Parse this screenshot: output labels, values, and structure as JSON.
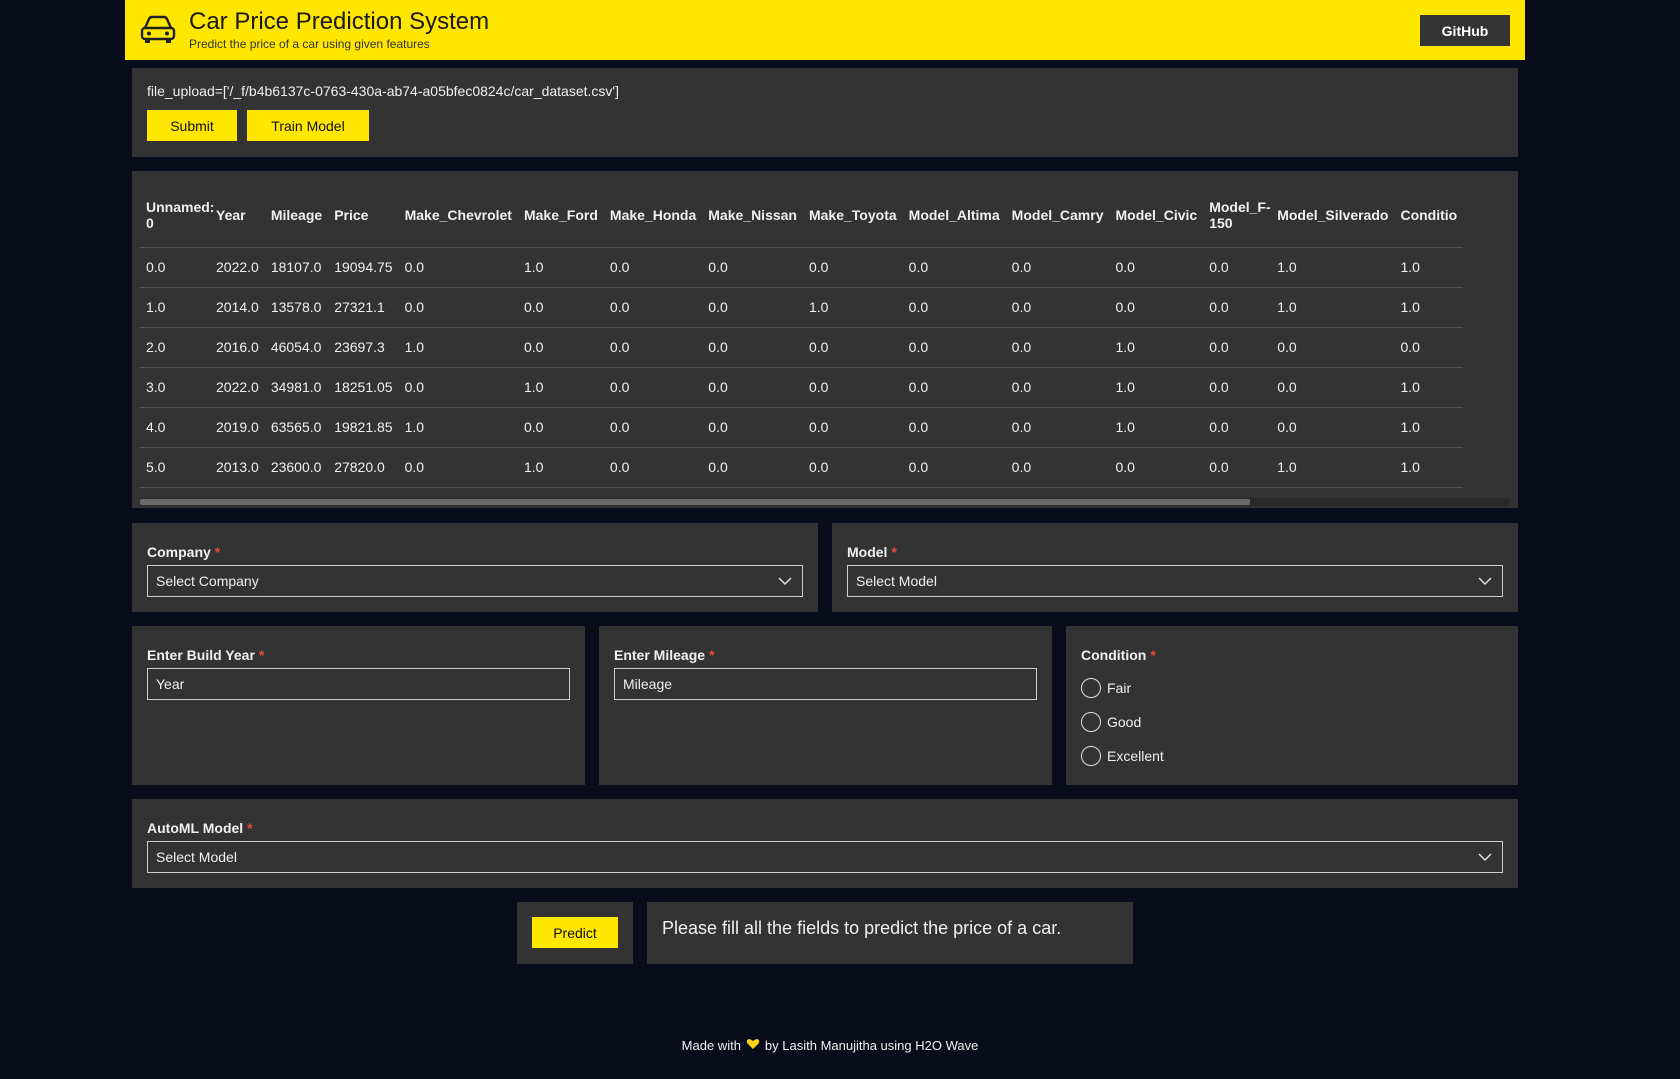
{
  "header": {
    "title": "Car Price Prediction System",
    "subtitle": "Predict the price of a car using given features",
    "github_label": "GitHub",
    "icon": "car-icon",
    "accent_color": "#ffe600"
  },
  "upload": {
    "file_text": "file_upload=['/_f/b4b6137c-0763-430a-ab74-a05bfec0824c/car_dataset.csv']",
    "submit_label": "Submit",
    "train_label": "Train Model"
  },
  "table": {
    "columns": [
      "Unnamed: 0",
      "Year",
      "Mileage",
      "Price",
      "Make_Chevrolet",
      "Make_Ford",
      "Make_Honda",
      "Make_Nissan",
      "Make_Toyota",
      "Model_Altima",
      "Model_Camry",
      "Model_Civic",
      "Model_F-150",
      "Model_Silverado",
      "Conditio"
    ],
    "rows": [
      [
        "0.0",
        "2022.0",
        "18107.0",
        "19094.75",
        "0.0",
        "1.0",
        "0.0",
        "0.0",
        "0.0",
        "0.0",
        "0.0",
        "0.0",
        "0.0",
        "1.0",
        "1.0"
      ],
      [
        "1.0",
        "2014.0",
        "13578.0",
        "27321.1",
        "0.0",
        "0.0",
        "0.0",
        "0.0",
        "1.0",
        "0.0",
        "0.0",
        "0.0",
        "0.0",
        "1.0",
        "1.0"
      ],
      [
        "2.0",
        "2016.0",
        "46054.0",
        "23697.3",
        "1.0",
        "0.0",
        "0.0",
        "0.0",
        "0.0",
        "0.0",
        "0.0",
        "1.0",
        "0.0",
        "0.0",
        "0.0"
      ],
      [
        "3.0",
        "2022.0",
        "34981.0",
        "18251.05",
        "0.0",
        "1.0",
        "0.0",
        "0.0",
        "0.0",
        "0.0",
        "0.0",
        "1.0",
        "0.0",
        "0.0",
        "1.0"
      ],
      [
        "4.0",
        "2019.0",
        "63565.0",
        "19821.85",
        "1.0",
        "0.0",
        "0.0",
        "0.0",
        "0.0",
        "0.0",
        "0.0",
        "1.0",
        "0.0",
        "0.0",
        "1.0"
      ],
      [
        "5.0",
        "2013.0",
        "23600.0",
        "27820.0",
        "0.0",
        "1.0",
        "0.0",
        "0.0",
        "0.0",
        "0.0",
        "0.0",
        "0.0",
        "0.0",
        "1.0",
        "1.0"
      ]
    ]
  },
  "company": {
    "label": "Company",
    "required": "*",
    "value": "Select Company"
  },
  "model": {
    "label": "Model",
    "required": "*",
    "value": "Select Model"
  },
  "build_year": {
    "label": "Enter Build Year",
    "required": "*",
    "placeholder": "Year"
  },
  "mileage": {
    "label": "Enter Mileage",
    "required": "*",
    "placeholder": "Mileage"
  },
  "condition": {
    "label": "Condition",
    "required": "*",
    "options": [
      "Fair",
      "Good",
      "Excellent"
    ]
  },
  "automl": {
    "label": "AutoML Model",
    "required": "*",
    "value": "Select Model"
  },
  "predict": {
    "button_label": "Predict",
    "message": "Please fill all the fields to predict the price of a car."
  },
  "footer": {
    "prefix": "Made with",
    "suffix": "by Lasith Manujitha using H2O Wave",
    "icon": "heart-icon"
  }
}
